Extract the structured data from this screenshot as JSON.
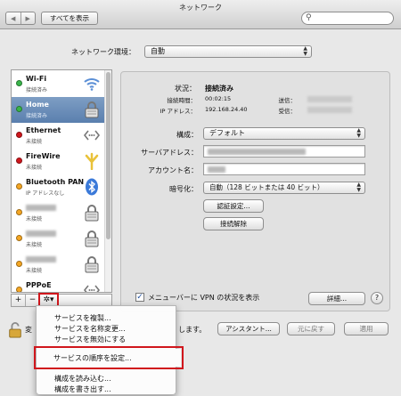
{
  "window": {
    "title": "ネットワーク"
  },
  "toolbar": {
    "back_glyph": "◀",
    "forward_glyph": "▶",
    "show_all_label": "すべてを表示",
    "search_placeholder": "",
    "search_icon_glyph": "🔍"
  },
  "location": {
    "label": "ネットワーク環境：",
    "value": "自動"
  },
  "services": [
    {
      "name": "Wi-Fi",
      "status": "接続済み",
      "dot_color": "#39b54a",
      "icon": "wifi-icon",
      "redacted": false
    },
    {
      "name": "Home",
      "status": "接続済み",
      "dot_color": "#39b54a",
      "icon": "lock-icon",
      "redacted": false,
      "selected": true
    },
    {
      "name": "Ethernet",
      "status": "未接続",
      "dot_color": "#d0161c",
      "icon": "ethernet-icon",
      "redacted": false
    },
    {
      "name": "FireWire",
      "status": "未接続",
      "dot_color": "#d0161c",
      "icon": "firewire-icon",
      "redacted": false
    },
    {
      "name": "Bluetooth PAN",
      "status": "IP アドレスなし",
      "dot_color": "#f5a623",
      "icon": "bluetooth-icon",
      "redacted": false
    },
    {
      "name": "",
      "status": "未接続",
      "dot_color": "#f5a623",
      "icon": "lock-icon",
      "redacted": true
    },
    {
      "name": "",
      "status": "未接続",
      "dot_color": "#f5a623",
      "icon": "lock-icon",
      "redacted": true
    },
    {
      "name": "",
      "status": "未接続",
      "dot_color": "#f5a623",
      "icon": "lock-icon",
      "redacted": true
    },
    {
      "name": "PPPoE",
      "status": "未接続",
      "dot_color": "#f5a623",
      "icon": "ethernet-icon",
      "redacted": false
    }
  ],
  "list_buttons": {
    "add": "+",
    "remove": "−",
    "gear": "✲▾"
  },
  "detail": {
    "status_label": "状況：",
    "status_value": "接続済み",
    "connect_time_label": "接続時間：",
    "connect_time_value": "00:02:15",
    "ip_label": "IP アドレス：",
    "ip_value": "192.168.24.40",
    "sent_label": "送信：",
    "received_label": "受信：",
    "config_label": "構成：",
    "config_value": "デフォルト",
    "server_label": "サーバアドレス：",
    "account_label": "アカウント名：",
    "encryption_label": "暗号化：",
    "encryption_value": "自動（128 ビットまたは 40 ビット）",
    "auth_button": "認証設定...",
    "disconnect_button": "接続解除",
    "menubar_checkbox_label": "メニューバーに VPN の状況を表示",
    "menubar_checked": true,
    "advanced_button": "詳細...",
    "help_button": "?"
  },
  "bottom": {
    "lock_text_left": "変",
    "lock_text_right": "します。",
    "assistant_button": "アシスタント...",
    "revert_button": "元に戻す",
    "apply_button": "適用"
  },
  "menu": {
    "items": [
      "サービスを複製...",
      "サービスを名称変更...",
      "サービスを無効にする",
      "サービスの順序を設定...",
      "構成を読み込む...",
      "構成を書き出す..."
    ],
    "highlighted_index": 3,
    "highlight_color": "#d0161c"
  }
}
